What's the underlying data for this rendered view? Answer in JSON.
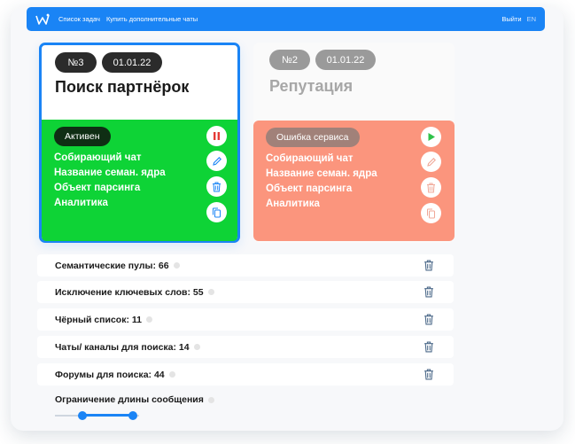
{
  "topbar": {
    "nav": [
      "Список задач",
      "Купить дополнительные чаты"
    ],
    "logout": "Выйти",
    "lang": "EN"
  },
  "cards": [
    {
      "number": "№3",
      "date": "01.01.22",
      "title": "Поиск партнёрок",
      "status": "Активен",
      "lines": [
        "Собирающий чат",
        "Название семан. ядра",
        "Объект парсинга",
        "Аналитика"
      ],
      "panel_color": "#0ed336",
      "actions": [
        "pause-icon",
        "edit-icon",
        "trash-icon",
        "copy-icon"
      ]
    },
    {
      "number": "№2",
      "date": "01.01.22",
      "title": "Репутация",
      "status": "Ошибка сервиса",
      "lines": [
        "Собирающий чат",
        "Название семан. ядра",
        "Объект парсинга",
        "Аналитика"
      ],
      "panel_color": "#fb957d",
      "actions": [
        "play-icon",
        "edit-icon",
        "trash-icon",
        "copy-icon"
      ]
    }
  ],
  "settings": [
    "Семантические пулы: 66",
    "Исключение ключевых слов: 55",
    "Чёрный список: 11",
    "Чаты/ каналы для поиска: 14",
    "Форумы для поиска: 44"
  ],
  "limit": {
    "label": "Ограничение длины сообщения",
    "range": [
      0.33,
      0.93
    ]
  },
  "colors": {
    "accent": "#1a84f5",
    "active": "#0ed336",
    "error": "#fb957d",
    "pause": "#e53935",
    "play": "#2fc24a"
  }
}
